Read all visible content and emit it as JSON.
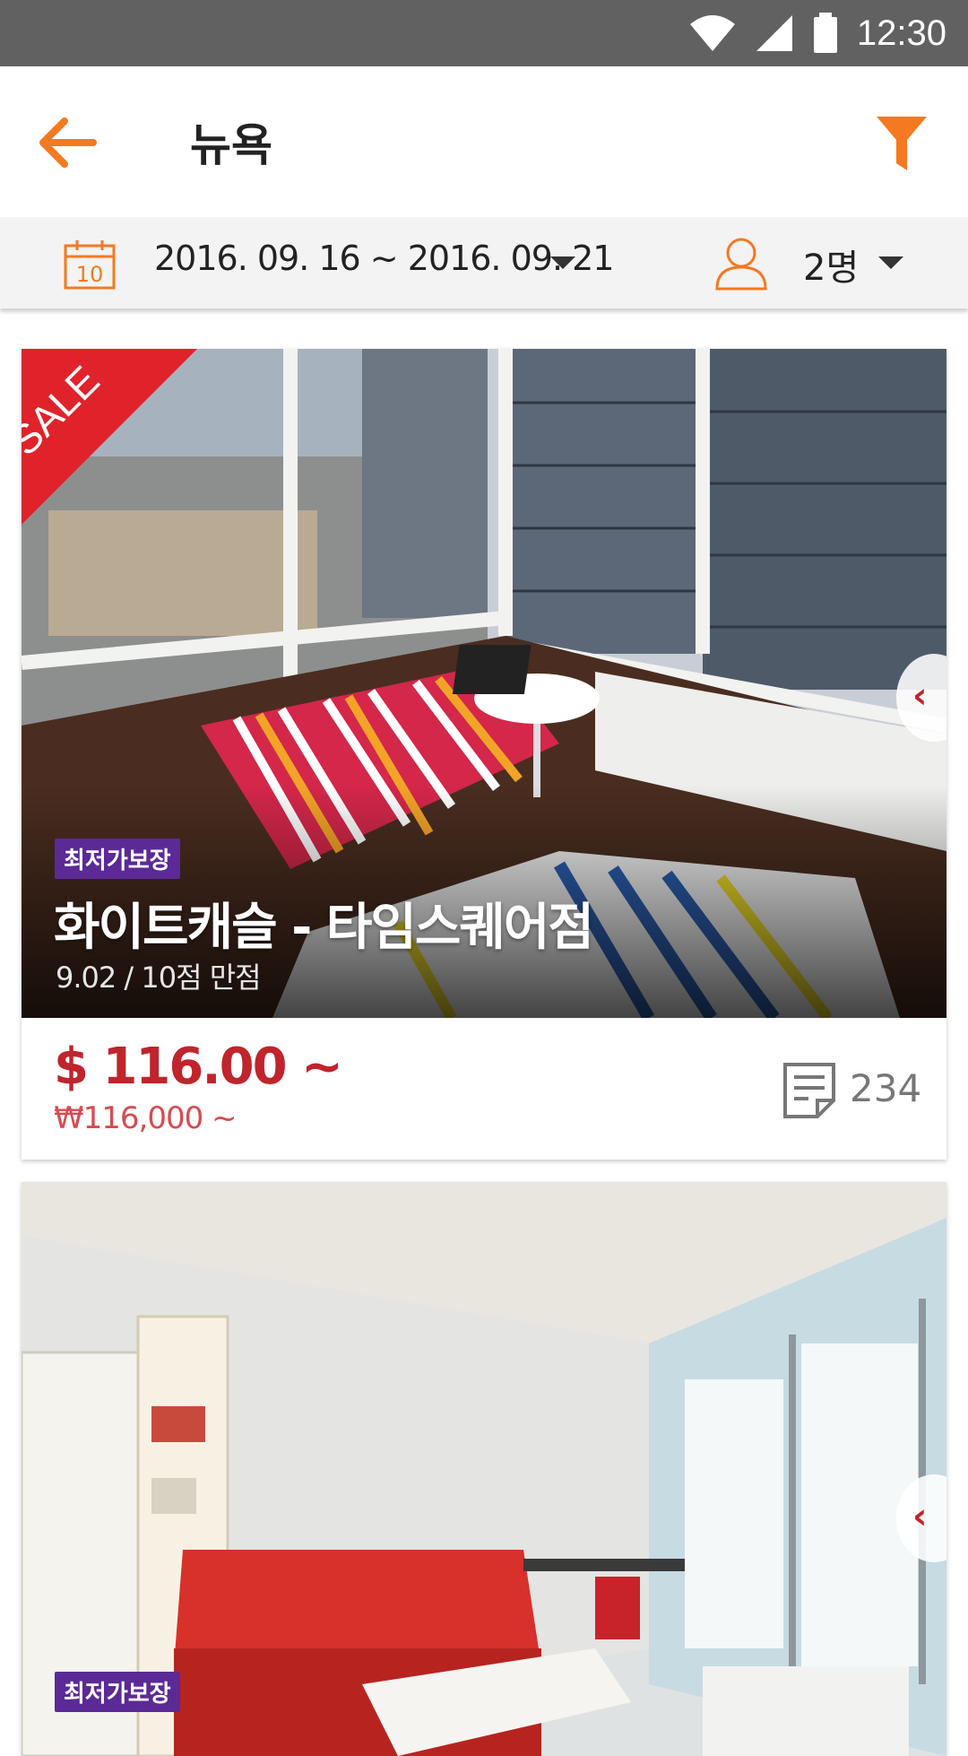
{
  "status_bar": {
    "time": "12:30"
  },
  "app_bar": {
    "title": "뉴욕"
  },
  "filter_bar": {
    "date_range": "2016. 09. 16 ~ 2016. 09. 21",
    "calendar_day": "10",
    "guests": "2명"
  },
  "listings": [
    {
      "sale_label": "SALE",
      "badge": "최저가보장",
      "name": "화이트캐슬 - 타임스퀘어점",
      "rating": "9.02 / 10점 만점",
      "price_usd": "$ 116.00 ~",
      "price_krw": "₩116,000 ~",
      "review_count": "234"
    },
    {
      "badge": "최저가보장"
    }
  ],
  "colors": {
    "accent": "#f47920",
    "price": "#c0242c",
    "badge": "#5b2a96",
    "sale": "#e0232a"
  }
}
